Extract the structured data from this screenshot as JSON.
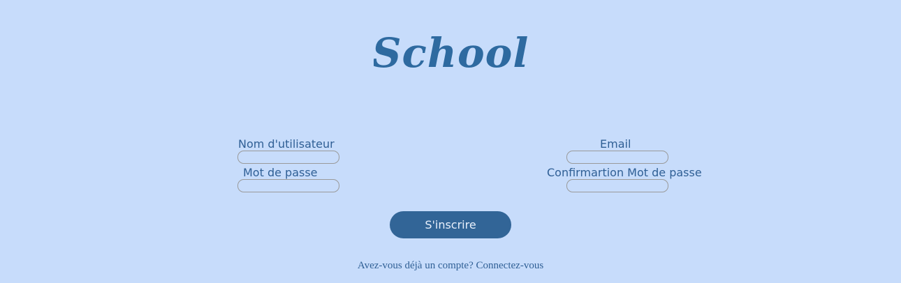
{
  "brand": {
    "logo_text": "School",
    "logo_color": "#2e6aa0"
  },
  "form": {
    "username_label": "Nom d'utilisateur",
    "password_label": "Mot de passe",
    "email_label": "Email",
    "confirm_password_label": "Confirmartion Mot de passe",
    "username_value": "",
    "password_value": "",
    "email_value": "",
    "confirm_password_value": "",
    "submit_label": "S'inscrire"
  },
  "footer": {
    "prompt_text": "Avez-vous déjà un compte?",
    "login_link_text": "Connectez-vous"
  },
  "colors": {
    "background": "#c7dcfb",
    "primary": "#326597",
    "text": "#2f5f95"
  }
}
